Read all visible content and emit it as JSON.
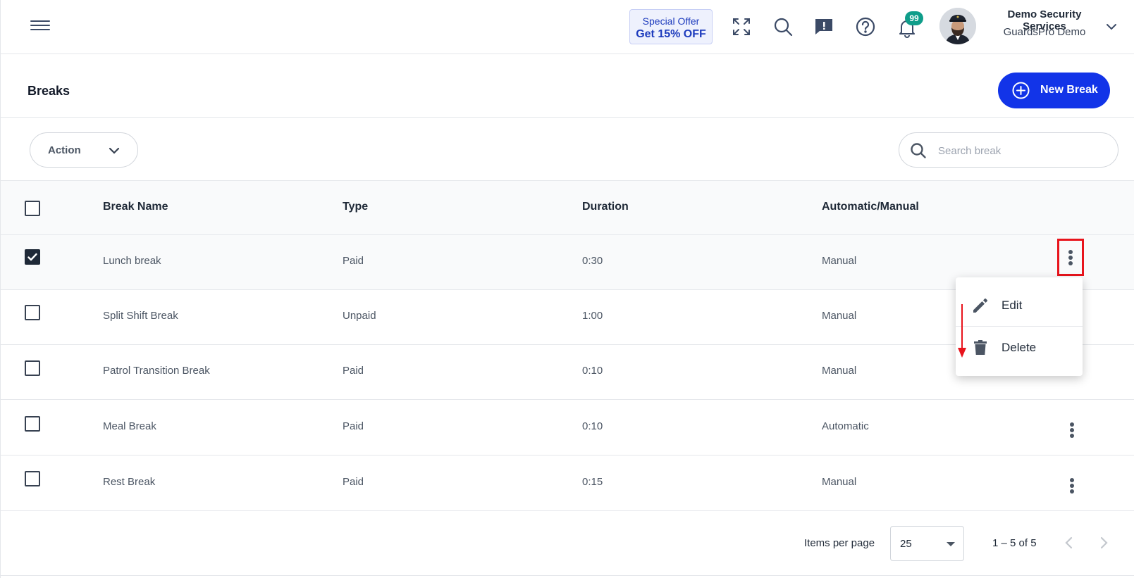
{
  "header": {
    "offer": {
      "line1": "Special Offer",
      "line2": "Get 15% OFF"
    },
    "notifications": {
      "count": "99"
    },
    "user": {
      "name": "Demo Security Services",
      "org": "GuardsPro Demo"
    },
    "icons": [
      "menu-icon",
      "fullscreen-icon",
      "search-icon",
      "feedback-icon",
      "help-icon",
      "bell-icon",
      "chevron-down-icon"
    ]
  },
  "page": {
    "title": "Breaks",
    "new_button": "New Break"
  },
  "toolbar": {
    "action_label": "Action",
    "search_placeholder": "Search break"
  },
  "table": {
    "columns": [
      "Break Name",
      "Type",
      "Duration",
      "Automatic/Manual"
    ],
    "rows": [
      {
        "name": "Lunch break",
        "type": "Paid",
        "duration": "0:30",
        "mode": "Manual",
        "checked": true
      },
      {
        "name": "Split Shift Break",
        "type": "Unpaid",
        "duration": "1:00",
        "mode": "Manual",
        "checked": false
      },
      {
        "name": "Patrol Transition Break",
        "type": "Paid",
        "duration": "0:10",
        "mode": "Manual",
        "checked": false
      },
      {
        "name": "Meal Break",
        "type": "Paid",
        "duration": "0:10",
        "mode": "Automatic",
        "checked": false
      },
      {
        "name": "Rest Break",
        "type": "Paid",
        "duration": "0:15",
        "mode": "Manual",
        "checked": false
      }
    ]
  },
  "row_menu": {
    "edit": "Edit",
    "delete": "Delete"
  },
  "pagination": {
    "items_per_page_label": "Items per page",
    "items_per_page": "25",
    "range": "1 – 5 of 5"
  },
  "colors": {
    "primary": "#1234e8",
    "highlight": "#e8141c",
    "badge": "#0f9d8a"
  }
}
